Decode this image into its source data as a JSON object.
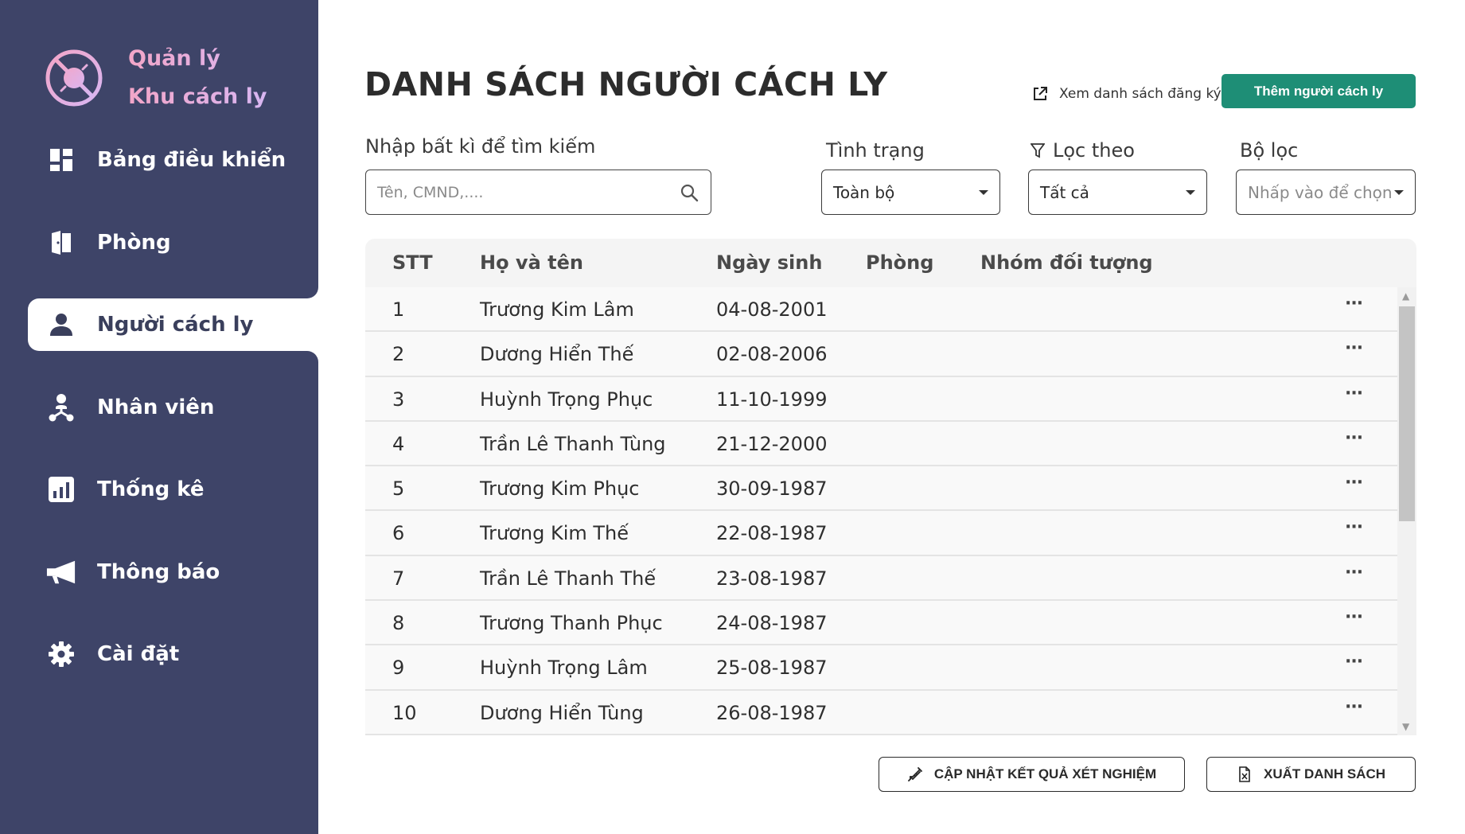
{
  "brand": {
    "line1": "Quản lý",
    "line2": "Khu cách ly"
  },
  "nav": {
    "items": [
      {
        "label": "Bảng điều khiển",
        "icon": "dashboard-icon"
      },
      {
        "label": "Phòng",
        "icon": "room-icon"
      },
      {
        "label": "Người cách ly",
        "icon": "person-icon",
        "active": true
      },
      {
        "label": "Nhân viên",
        "icon": "staff-icon"
      },
      {
        "label": "Thống kê",
        "icon": "chart-icon"
      },
      {
        "label": "Thông báo",
        "icon": "megaphone-icon"
      },
      {
        "label": "Cài đặt",
        "icon": "gear-icon"
      }
    ]
  },
  "header": {
    "title": "DANH SÁCH NGƯỜI CÁCH LY",
    "view_link": "Xem danh sách đăng ký",
    "add_button": "Thêm người cách ly"
  },
  "search": {
    "label": "Nhập bất kì để tìm kiếm",
    "placeholder": "Tên, CMND,...."
  },
  "filters": {
    "status": {
      "label": "Tình trạng",
      "value": "Toàn bộ"
    },
    "filter_by": {
      "label": "Lọc theo",
      "value": "Tất cả"
    },
    "filter": {
      "label": "Bộ lọc",
      "placeholder": "Nhấp vào để chọn"
    }
  },
  "table": {
    "columns": [
      "STT",
      "Họ và tên",
      "Ngày sinh",
      "Phòng",
      "Nhóm đối tượng"
    ],
    "rows": [
      {
        "stt": "1",
        "name": "Trương Kim Lâm",
        "dob": "04-08-2001"
      },
      {
        "stt": "2",
        "name": "Dương Hiển Thế",
        "dob": "02-08-2006"
      },
      {
        "stt": "3",
        "name": "Huỳnh Trọng Phục",
        "dob": "11-10-1999"
      },
      {
        "stt": "4",
        "name": "Trần Lê Thanh Tùng",
        "dob": "21-12-2000"
      },
      {
        "stt": "5",
        "name": "Trương Kim Phục",
        "dob": "30-09-1987"
      },
      {
        "stt": "6",
        "name": "Trương Kim Thế",
        "dob": "22-08-1987"
      },
      {
        "stt": "7",
        "name": "Trần Lê Thanh Thế",
        "dob": "23-08-1987"
      },
      {
        "stt": "8",
        "name": "Trương Thanh Phục",
        "dob": "24-08-1987"
      },
      {
        "stt": "9",
        "name": "Huỳnh Trọng Lâm",
        "dob": "25-08-1987"
      },
      {
        "stt": "10",
        "name": "Dương Hiển Tùng",
        "dob": "26-08-1987"
      }
    ],
    "more_label": "···"
  },
  "actions": {
    "update_results": "CẬP NHẬT KẾT QUẢ XÉT NGHIỆM",
    "export": "XUẤT DANH SÁCH"
  },
  "colors": {
    "sidebar": "#3e4468",
    "accent": "#1e8e76",
    "brand_gradient": [
      "#f3a6c8",
      "#d8b6f2"
    ]
  }
}
